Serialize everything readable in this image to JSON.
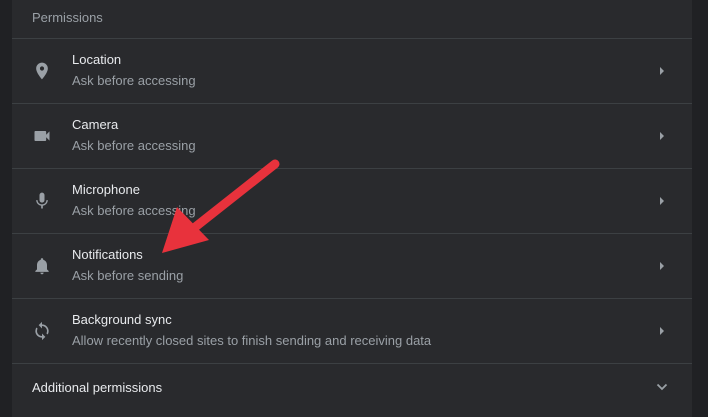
{
  "section": {
    "title": "Permissions"
  },
  "permissions": [
    {
      "icon": "location-pin-icon",
      "title": "Location",
      "subtitle": "Ask before accessing"
    },
    {
      "icon": "camera-icon",
      "title": "Camera",
      "subtitle": "Ask before accessing"
    },
    {
      "icon": "microphone-icon",
      "title": "Microphone",
      "subtitle": "Ask before accessing"
    },
    {
      "icon": "bell-icon",
      "title": "Notifications",
      "subtitle": "Ask before sending"
    },
    {
      "icon": "sync-icon",
      "title": "Background sync",
      "subtitle": "Allow recently closed sites to finish sending and receiving data"
    }
  ],
  "additional": {
    "label": "Additional permissions"
  },
  "colors": {
    "background": "#202124",
    "card": "#292a2d",
    "divider": "#3c4043",
    "text_primary": "#e8eaed",
    "text_secondary": "#9aa0a6",
    "annotation_arrow": "#e8323c"
  }
}
